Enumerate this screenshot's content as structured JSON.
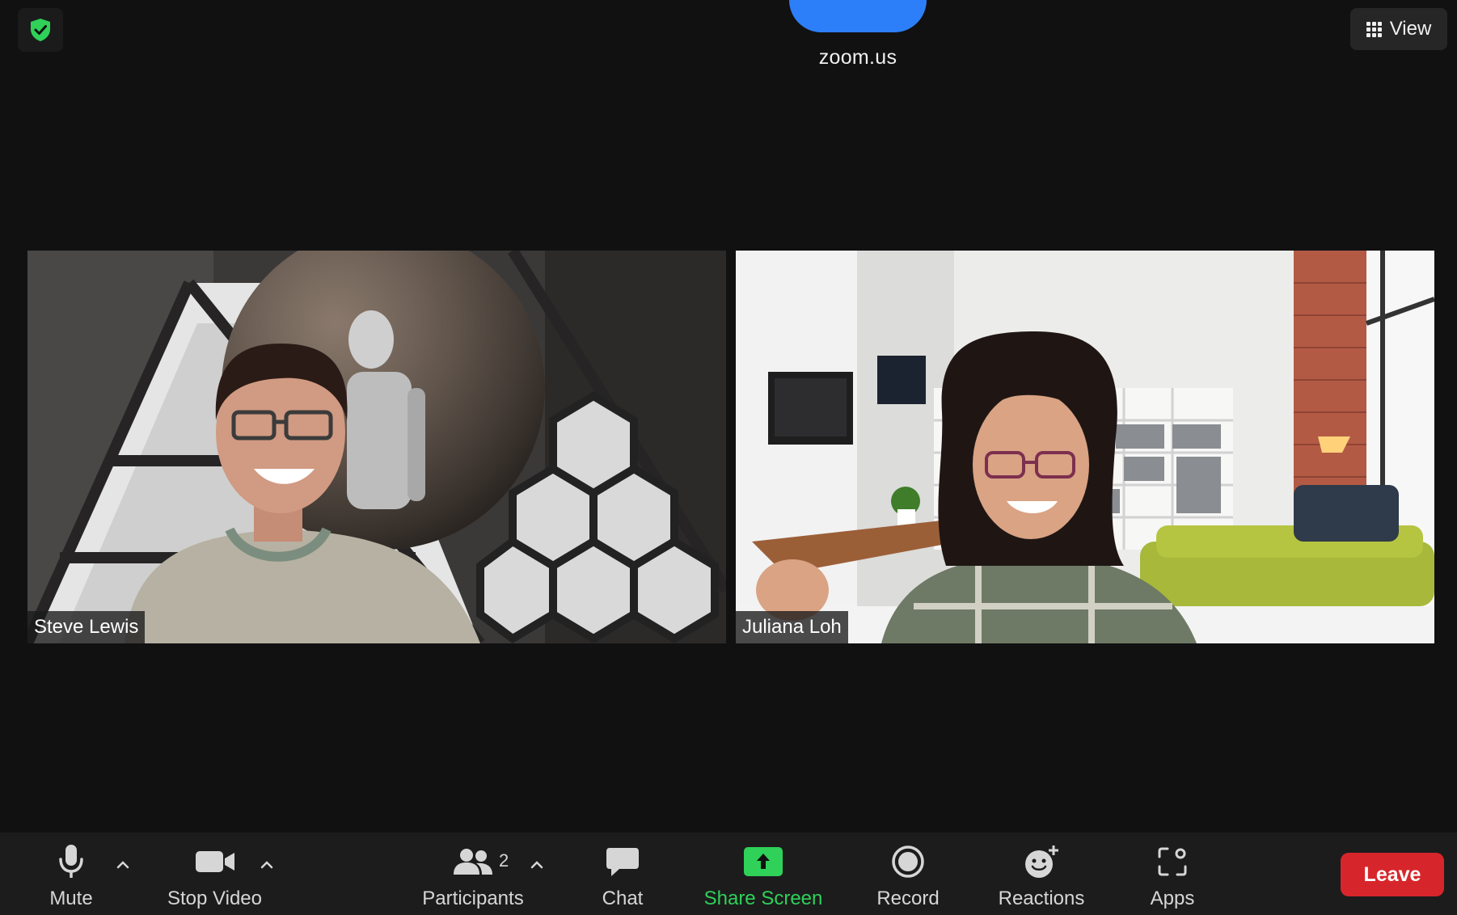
{
  "top": {
    "title": "zoom.us",
    "view_label": "View"
  },
  "participants": [
    {
      "name": "Steve Lewis"
    },
    {
      "name": "Juliana Loh"
    }
  ],
  "toolbar": {
    "mute_label": "Mute",
    "stop_video_label": "Stop Video",
    "participants_label": "Participants",
    "participants_count": "2",
    "chat_label": "Chat",
    "share_screen_label": "Share Screen",
    "record_label": "Record",
    "reactions_label": "Reactions",
    "apps_label": "Apps",
    "leave_label": "Leave"
  },
  "colors": {
    "background": "#111112",
    "toolbar": "#1c1c1d",
    "share_green": "#2fd158",
    "leave_red": "#d7262b",
    "shield_green": "#2fd158",
    "accent_blue": "#2d7ff9"
  },
  "icons": {
    "security": "shield-check-icon",
    "view": "grid-icon",
    "mute": "microphone-icon",
    "video": "video-camera-icon",
    "participants": "people-icon",
    "chat": "chat-bubble-icon",
    "share": "share-screen-icon",
    "record": "record-icon",
    "reactions": "smiley-plus-icon",
    "apps": "apps-icon"
  }
}
